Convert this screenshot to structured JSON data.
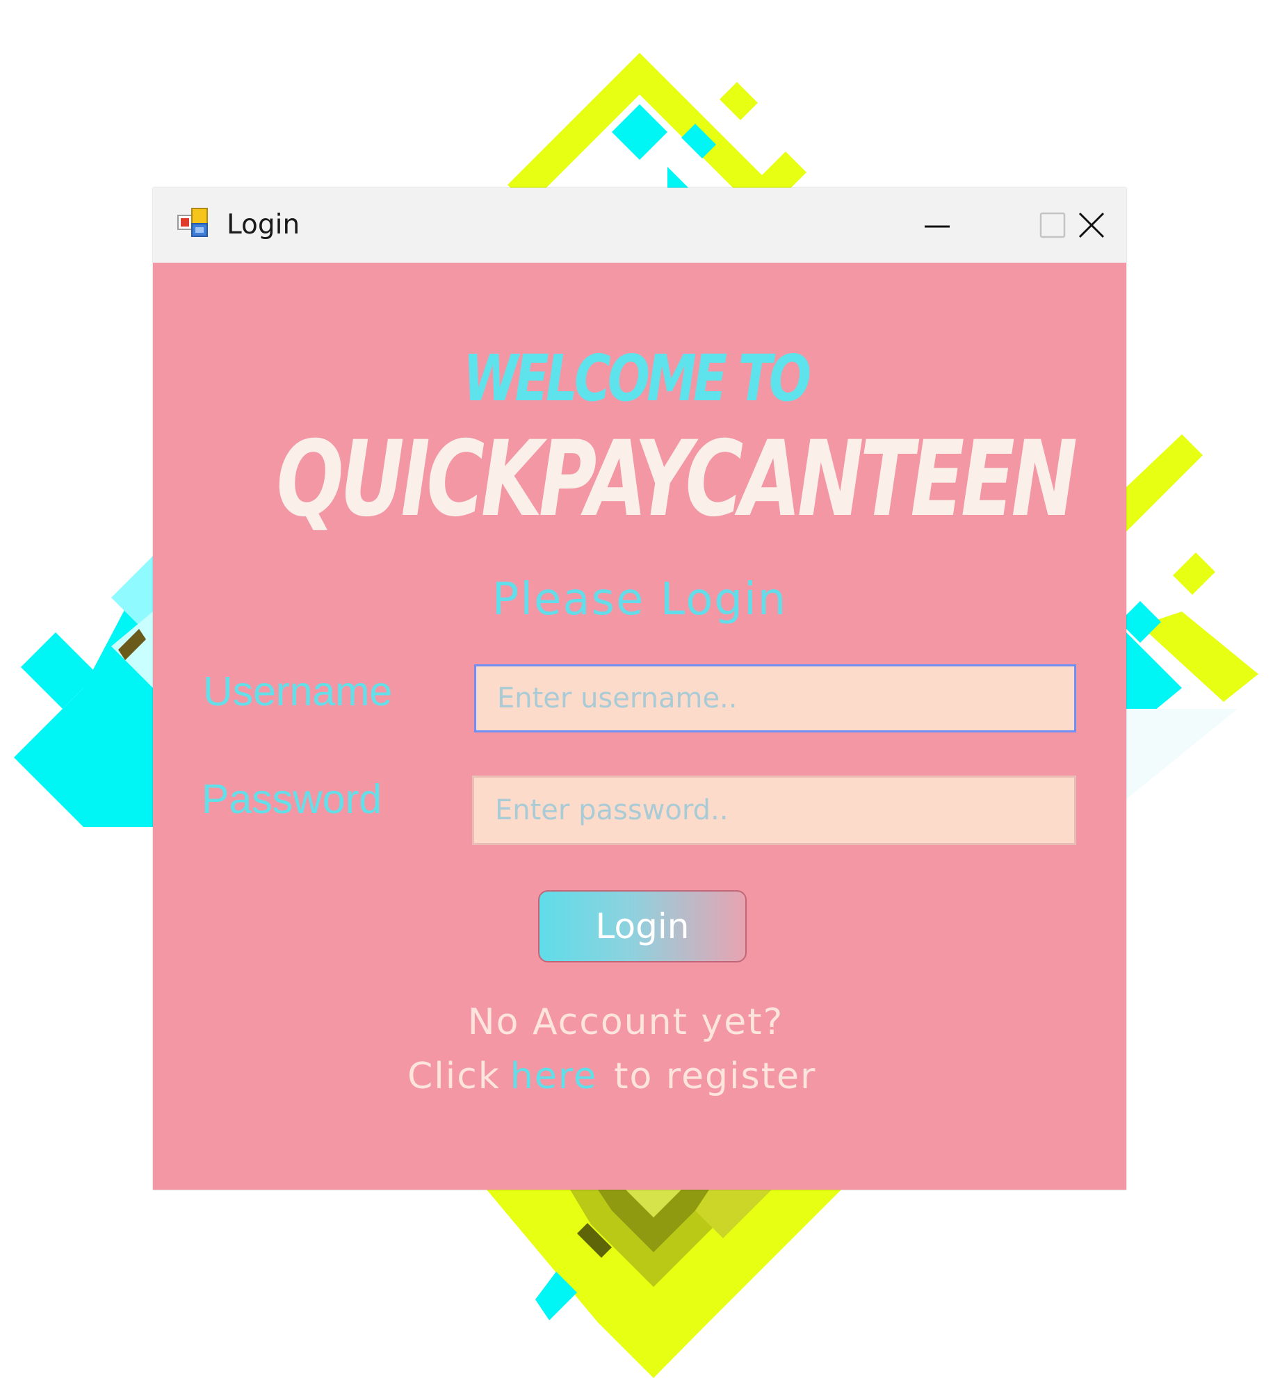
{
  "window": {
    "title": "Login",
    "controls": {
      "minimize": "minimize-icon",
      "maximize": "maximize-icon",
      "close": "close-icon"
    }
  },
  "header": {
    "welcome": "WELCOME TO",
    "brand": "QUICKPAYCANTEEN",
    "subtitle": "Please Login"
  },
  "form": {
    "username_label": "Username",
    "username_placeholder": "Enter username..",
    "username_value": "",
    "password_label": "Password",
    "password_placeholder": "Enter password..",
    "password_value": "",
    "login_button": "Login"
  },
  "footer": {
    "no_account": "No Account yet?",
    "click": "Click",
    "here": "here",
    "to_register": "to register"
  },
  "colors": {
    "content_background": "#f397a5",
    "accent_cyan": "#5ee3ec",
    "input_background": "#fcdbcb",
    "focus_border": "#6e8ff4",
    "decor_yellow": "#e6ff12",
    "decor_cyan": "#00f5f5"
  }
}
